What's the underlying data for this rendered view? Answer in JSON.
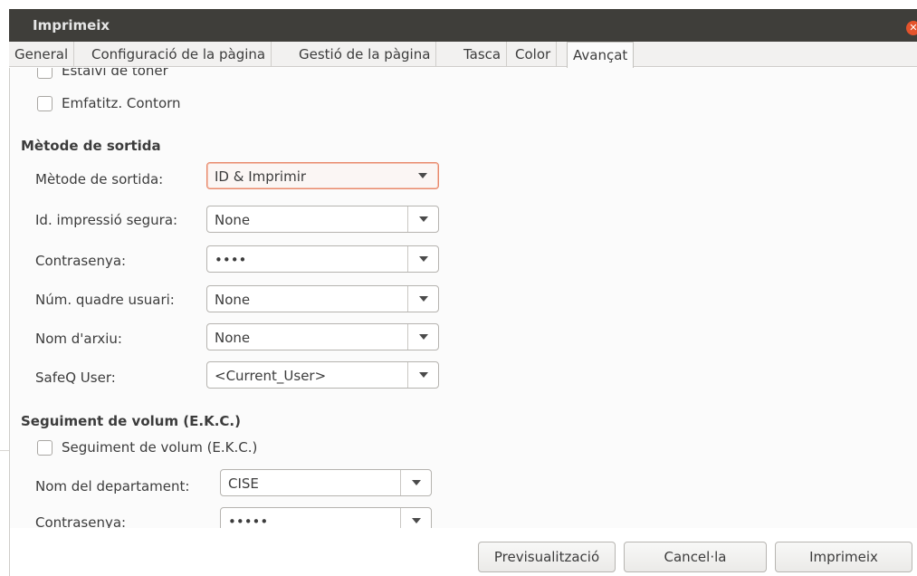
{
  "window": {
    "title": "Imprimeix",
    "close_icon": "close-icon"
  },
  "tabs": [
    {
      "label": "General"
    },
    {
      "label": "Configuració de la pàgina"
    },
    {
      "label": "Gestió de la pàgina"
    },
    {
      "label": "Tasca"
    },
    {
      "label": "Color"
    },
    {
      "label": "Avançat",
      "active": true
    }
  ],
  "options": {
    "toner_saving": "Estalvi de tòner",
    "emphasize_contour": "Emfatitz. Contorn"
  },
  "output_method": {
    "section_title": "Mètode de sortida",
    "fields": [
      {
        "label": "Mètode de sortida:",
        "value": "ID & Imprimir"
      },
      {
        "label": "Id. impressió segura:",
        "value": "None"
      },
      {
        "label": "Contrasenya:",
        "value": "••••"
      },
      {
        "label": "Núm. quadre usuari:",
        "value": "None"
      },
      {
        "label": "Nom d'arxiu:",
        "value": "None"
      },
      {
        "label": "SafeQ User:",
        "value": "<Current_User>"
      }
    ]
  },
  "volume_tracking": {
    "section_title": "Seguiment de volum (E.K.C.)",
    "checkbox_label": "Seguiment de volum (E.K.C.)",
    "fields": [
      {
        "label": "Nom del departament:",
        "value": "CISE"
      },
      {
        "label": "Contrasenya:",
        "value": "•••••"
      }
    ]
  },
  "buttons": {
    "preview": "Previsualització",
    "cancel": "Cancel·la",
    "print": "Imprimeix"
  },
  "colors": {
    "focus_accent": "#e8886a",
    "titlebar": "#3f3e3a",
    "close": "#e4532c"
  }
}
